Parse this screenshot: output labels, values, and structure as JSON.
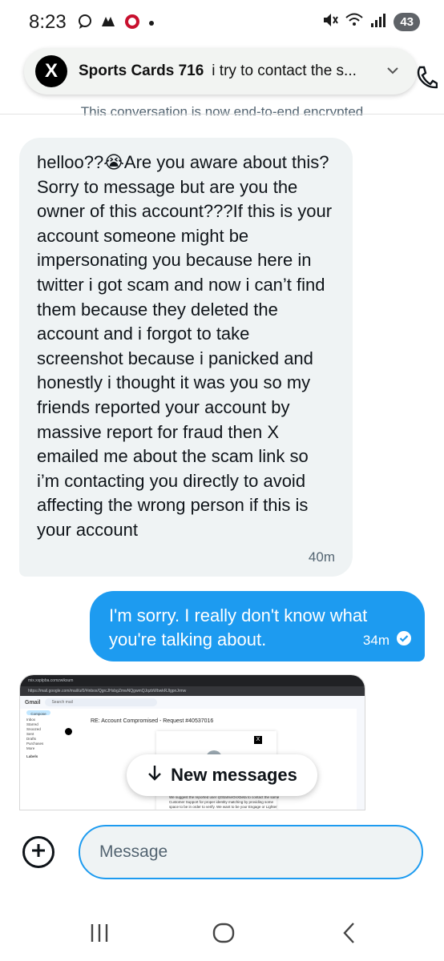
{
  "status_bar": {
    "time": "8:23",
    "battery": "43"
  },
  "notification": {
    "app_logo": "X",
    "sender": "Sports Cards 716",
    "preview": "i try to contact the s..."
  },
  "conversation": {
    "encryption_note": "This conversation is now end-to-end encrypted",
    "received_message": {
      "text": "helloo??😭Are you aware about this?Sorry to message but are you the owner of this account???If this is your account someone might be impersonating you because here in twitter i got scam and now i can’t find them because they deleted the account and i forgot to take screenshot because i panicked and honestly i thought it was you so my friends reported your account by massive report for fraud then X emailed me about the scam link so i’m contacting you directly to avoid affecting the wrong person if this is your account",
      "time": "40m"
    },
    "sent_message": {
      "text": "I'm sorry. I really don't know what you're talking about.",
      "time": "34m"
    },
    "attachment": {
      "tab_title": "mix.xsplpba.comzwiksum",
      "url": "https://mail.google.com/mail/u/0/#inbox/QgrcJHsbgZmwNQgwmQJqzbWbwkRJlgpnJrmw",
      "gmail_label": "Gmail",
      "search_placeholder": "Search mail",
      "compose": "Compose",
      "folders": [
        "Inbox",
        "Starred",
        "Snoozed",
        "Sent",
        "Drafts",
        "Purchases",
        "More"
      ],
      "labels_heading": "Labels",
      "subject": "RE: Account Compromised - Request #40537016",
      "body_text": "We suggest the reported user @StarlseOnXbeta to contact the same Customer Support for proper identity matching by providing some space to be in order to verify. We want to be your Engage or Lighter Platform"
    },
    "new_messages_label": "New messages"
  },
  "composer": {
    "placeholder": "Message"
  },
  "icons": {
    "speech-bubble-icon": "status",
    "gear-icon": "status",
    "mute-icon": "status",
    "wifi-icon": "status",
    "signal-icon": "status",
    "chevron-down-icon": "notification",
    "phone-icon": "header",
    "verified-check-icon": "sent",
    "arrow-down-icon": "pill",
    "plus-icon": "composer",
    "recent-apps-icon": "nav",
    "home-icon": "nav",
    "back-icon": "nav"
  },
  "colors": {
    "accent": "#1d9bf0",
    "received_bubble": "#eff3f4",
    "text_primary": "#0f1419",
    "text_secondary": "#536471"
  }
}
